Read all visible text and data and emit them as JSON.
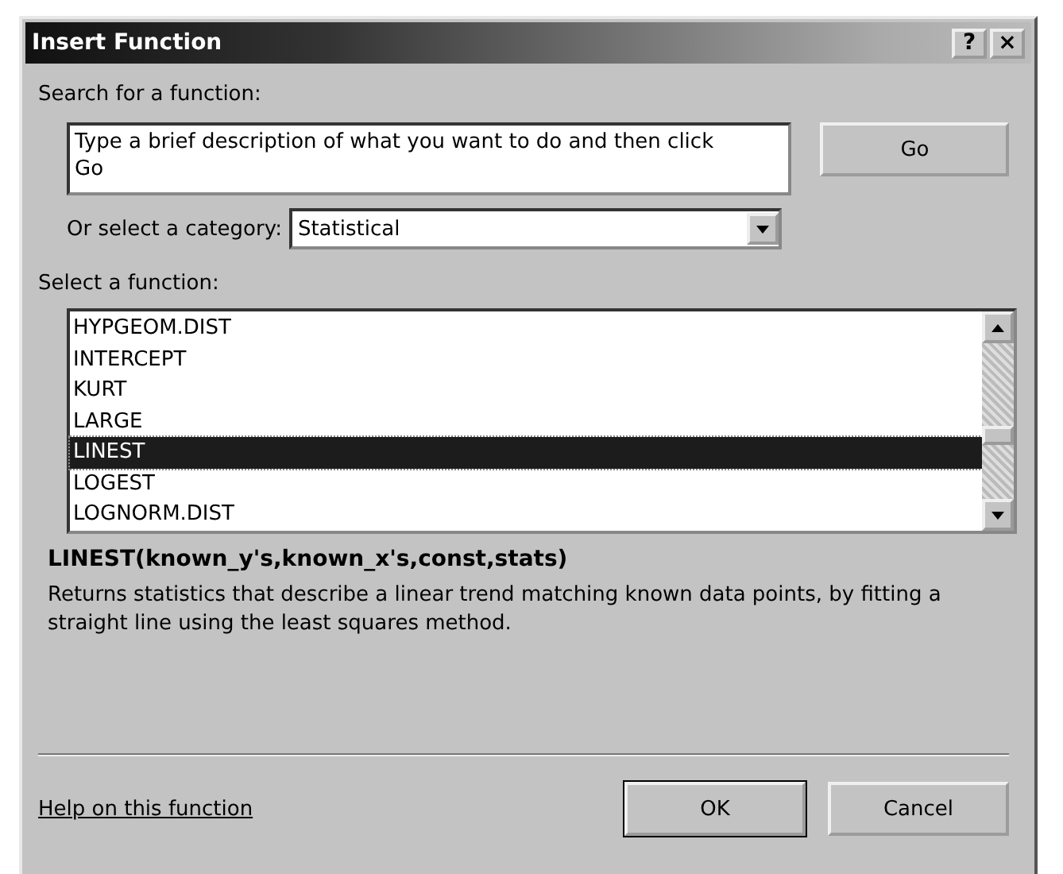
{
  "window": {
    "title": "Insert Function",
    "buttons": [
      "?",
      "×"
    ]
  },
  "search": {
    "label": "Search for a function:",
    "value": "Type a brief description of what you want to do and then click Go",
    "button": "Go"
  },
  "category": {
    "label": "Or select a category:",
    "value": "Statistical"
  },
  "functions": {
    "label": "Select a function:",
    "items": [
      {
        "name": "HYPGEOM.DIST",
        "selected": false
      },
      {
        "name": "INTERCEPT",
        "selected": false
      },
      {
        "name": "KURT",
        "selected": false
      },
      {
        "name": "LARGE",
        "selected": false
      },
      {
        "name": "LINEST",
        "selected": true
      },
      {
        "name": "LOGEST",
        "selected": false
      },
      {
        "name": "LOGNORM.DIST",
        "selected": false
      }
    ]
  },
  "signature": "LINEST(known_y's,known_x's,const,stats)",
  "description": "Returns statistics that describe a linear trend matching known data points, by fitting a straight line using the least squares method.",
  "help_link": "Help on this function",
  "buttons": [
    {
      "label": "OK",
      "default": true
    },
    {
      "label": "Cancel",
      "default": false
    }
  ]
}
